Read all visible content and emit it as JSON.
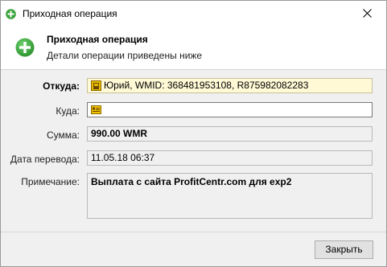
{
  "window": {
    "title": "Приходная операция",
    "close_glyph": "✕"
  },
  "header": {
    "title": "Приходная операция",
    "subtitle": "Детали операции приведены ниже",
    "icon": "plus-circle-icon",
    "accent_color": "#3aa33a"
  },
  "form": {
    "from_label": "Откуда:",
    "from_value": "Юрий, WMID: 368481953108, R875982082283",
    "to_label": "Куда:",
    "to_value": "",
    "amount_label": "Сумма:",
    "amount_value": "990.00 WMR",
    "date_label": "Дата перевода:",
    "date_value": "11.05.18 06:37",
    "note_label": "Примечание:",
    "note_value": "Выплата с сайта ProfitCentr.com для exp2"
  },
  "footer": {
    "close_button_label": "Закрыть"
  }
}
